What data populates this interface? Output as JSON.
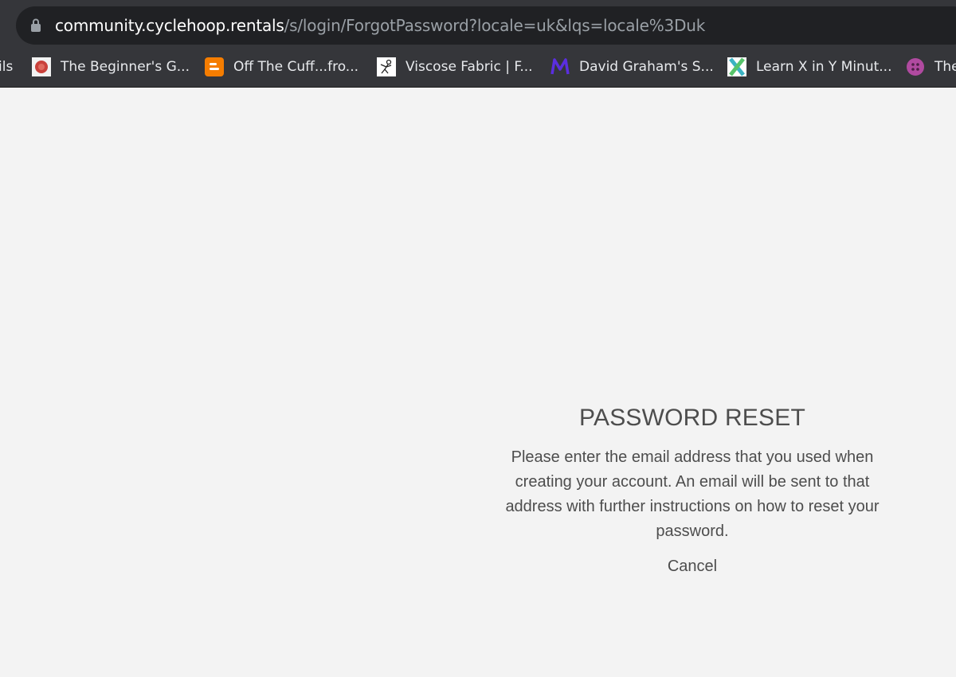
{
  "browser": {
    "url_host": "community.cyclehoop.rentals",
    "url_path": "/s/login/ForgotPassword?locale=uk&lqs=locale%3Duk",
    "bookmarks": [
      {
        "label": "ils",
        "icon": "none"
      },
      {
        "label": "The Beginner's G...",
        "icon": "red-circle-icon"
      },
      {
        "label": "Off The Cuff...fro...",
        "icon": "blogger-icon"
      },
      {
        "label": "Viscose Fabric | F...",
        "icon": "stick-figure-icon"
      },
      {
        "label": "David Graham's S...",
        "icon": "purple-m-icon"
      },
      {
        "label": "Learn X in Y Minut...",
        "icon": "x-logo-icon"
      },
      {
        "label": "The",
        "icon": "purple-circle-icon"
      }
    ]
  },
  "reset": {
    "title": "PASSWORD RESET",
    "instructions": "Please enter the email address that you used when creating your account. An email will be sent to that address with further instructions on how to reset your password.",
    "cancel_label": "Cancel"
  },
  "colors": {
    "background": "#f3f3f3",
    "browser_chrome": "#35363a",
    "omnibox": "#202124",
    "text": "#4d4d4d"
  }
}
